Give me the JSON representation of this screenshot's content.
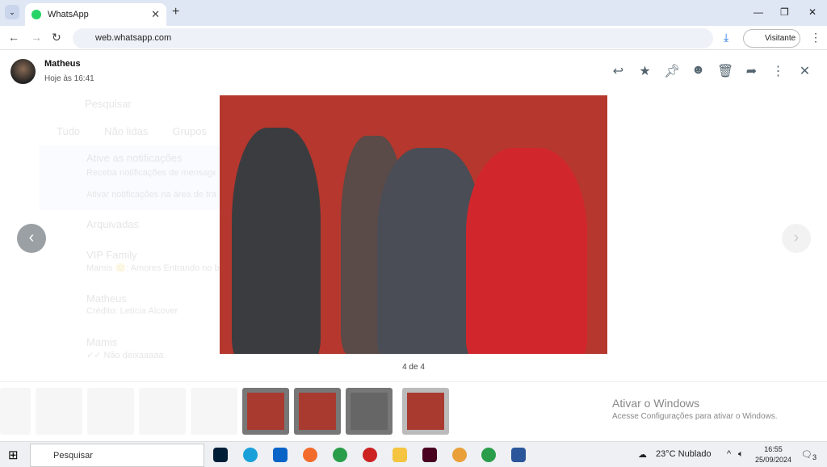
{
  "browser": {
    "tab_title": "WhatsApp",
    "url": "web.whatsapp.com",
    "profile": "Visitante"
  },
  "viewer": {
    "sender": "Matheus",
    "time": "Hoje às 16:41",
    "counter": "4 de 4",
    "tools": [
      "reply-icon",
      "star-icon",
      "pin-icon",
      "emoji-icon",
      "delete-icon",
      "forward-icon",
      "more-icon",
      "close-icon"
    ]
  },
  "background_chat": {
    "search": "Pesquisar",
    "filters": [
      "Tudo",
      "Não lidas",
      "Grupos"
    ],
    "notif_title": "Ative as notificações",
    "notif_text": "Receba notificações de mensagens novas no computador.",
    "notif_link": "Ativar notificações na área de trabalho",
    "archived": "Arquivadas",
    "chats": [
      {
        "name": "VIP Family",
        "preview": "Mamis 🙂: Amores Entrando no ba"
      },
      {
        "name": "Matheus",
        "preview": "Crédito: Letícia Alcover"
      },
      {
        "name": "Mamis",
        "preview": "✓✓ Não deixaaaaa"
      }
    ]
  },
  "activation": {
    "title": "Ativar o Windows",
    "subtitle": "Acesse Configurações para ativar o Windows."
  },
  "taskbar": {
    "search": "Pesquisar",
    "weather": "23°C  Nublado",
    "time": "16:55",
    "date": "25/09/2024",
    "notifications": "3"
  }
}
